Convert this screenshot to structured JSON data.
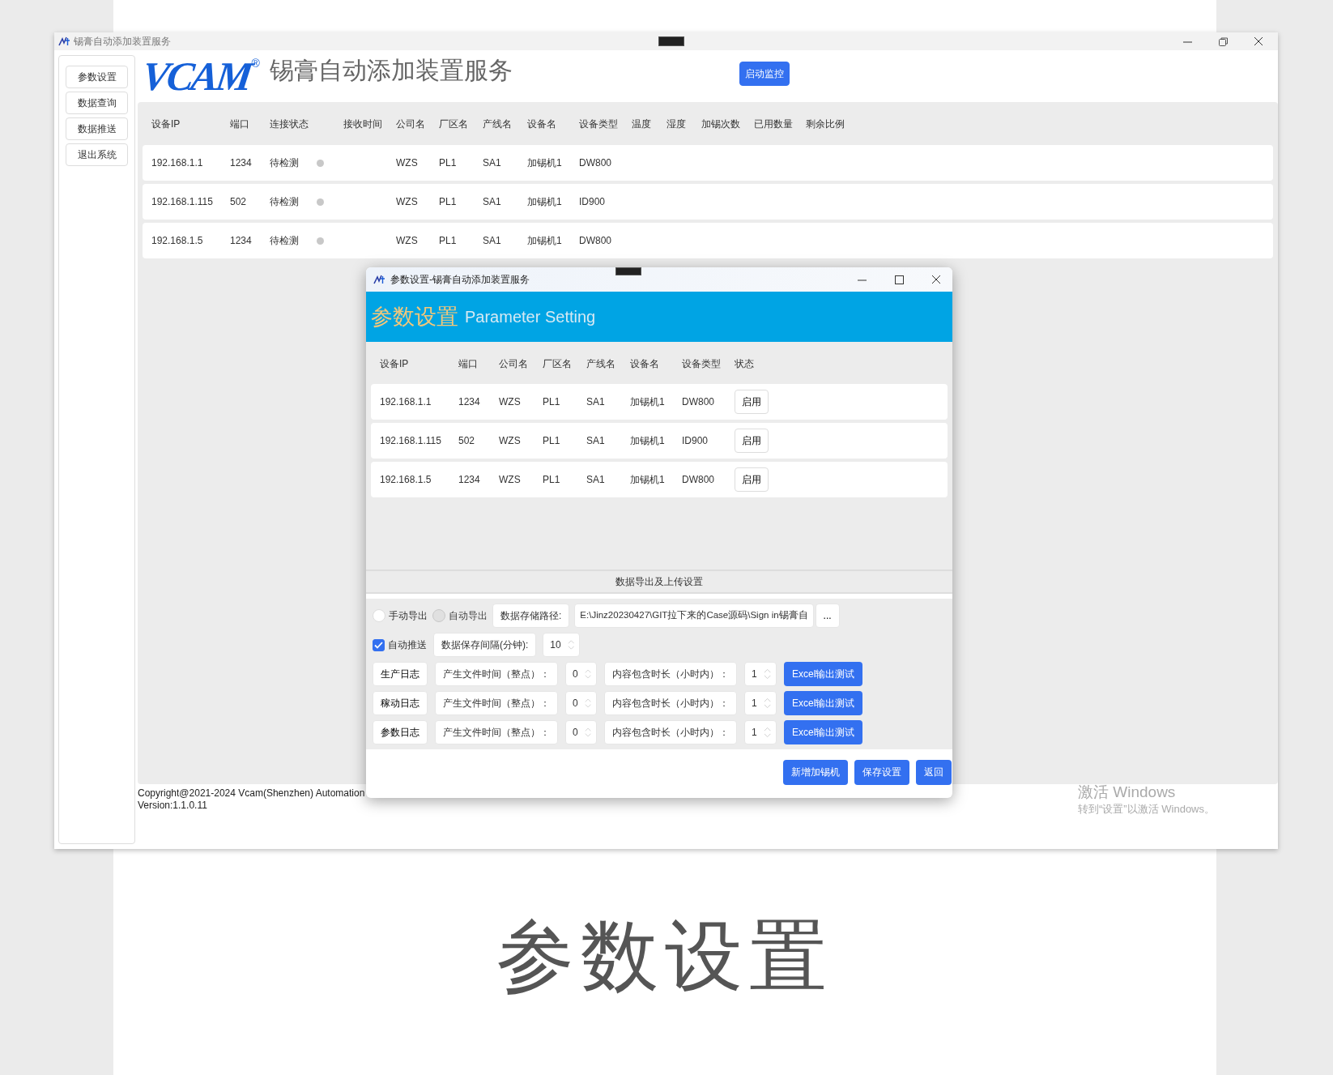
{
  "main_window": {
    "title": "锡膏自动添加装置服务",
    "sidebar": {
      "items": [
        {
          "label": "参数设置"
        },
        {
          "label": "数据查询"
        },
        {
          "label": "数据推送"
        },
        {
          "label": "退出系统"
        }
      ]
    },
    "logo": {
      "text": "VCAM",
      "mark": "®"
    },
    "app_title": "锡膏自动添加装置服务",
    "start_button": "启动监控",
    "table": {
      "columns": [
        "设备IP",
        "端口",
        "连接状态",
        "接收时间",
        "公司名",
        "厂区名",
        "产线名",
        "设备名",
        "设备类型",
        "温度",
        "湿度",
        "加锡次数",
        "已用数量",
        "剩余比例"
      ],
      "rows": [
        {
          "ip": "192.168.1.1",
          "port": "1234",
          "connection": "待检测",
          "color": "#c8c8c8",
          "company": "WZS",
          "plant": "PL1",
          "line": "SA1",
          "device": "加锡机1",
          "type": "DW800"
        },
        {
          "ip": "192.168.1.115",
          "port": "502",
          "connection": "待检测",
          "color": "#c8c8c8",
          "company": "WZS",
          "plant": "PL1",
          "line": "SA1",
          "device": "加锡机1",
          "type": "ID900"
        },
        {
          "ip": "192.168.1.5",
          "port": "1234",
          "connection": "待检测",
          "color": "#c8c8c8",
          "company": "WZS",
          "plant": "PL1",
          "line": "SA1",
          "device": "加锡机1",
          "type": "DW800"
        }
      ]
    },
    "footer": {
      "copyright": "Copyright@2021-2024 Vcam(Shenzhen) Automation",
      "version": "Version:1.1.0.11"
    },
    "activation": {
      "title": "激活 Windows",
      "text": "转到“设置”以激活 Windows。"
    }
  },
  "dialog": {
    "title": "参数设置-锡膏自动添加装置服务",
    "heading": "参数设置",
    "subheading": "Parameter Setting",
    "table": {
      "columns": [
        "设备IP",
        "端口",
        "公司名",
        "厂区名",
        "产线名",
        "设备名",
        "设备类型",
        "状态"
      ],
      "rows": [
        {
          "ip": "192.168.1.1",
          "port": "1234",
          "company": "WZS",
          "plant": "PL1",
          "line": "SA1",
          "device": "加锡机1",
          "type": "DW800",
          "action": "启用"
        },
        {
          "ip": "192.168.1.115",
          "port": "502",
          "company": "WZS",
          "plant": "PL1",
          "line": "SA1",
          "device": "加锡机1",
          "type": "ID900",
          "action": "启用"
        },
        {
          "ip": "192.168.1.5",
          "port": "1234",
          "company": "WZS",
          "plant": "PL1",
          "line": "SA1",
          "device": "加锡机1",
          "type": "DW800",
          "action": "启用"
        }
      ]
    },
    "section_title": "数据导出及上传设置",
    "export_modes": [
      {
        "label": "手动导出",
        "selected": false,
        "disabled": false
      },
      {
        "label": "自动导出",
        "selected": false,
        "disabled": true
      }
    ],
    "path_label": "数据存储路径:",
    "path_value": "E:\\Jinz20230427\\GIT拉下来的Case源码\\Sign in锡膏自",
    "browse_button": "...",
    "auto_push": {
      "label": "自动推送",
      "checked": true
    },
    "interval_label": "数据保存间隔(分钟):",
    "interval_value": "10",
    "logs": [
      {
        "name": "生产日志",
        "time_label": "产生文件时间（整点）：",
        "time_value": "0",
        "duration_label": "内容包含时长（小时内）：",
        "duration_value": "1",
        "test_button": "Excel输出测试"
      },
      {
        "name": "稼动日志",
        "time_label": "产生文件时间（整点）：",
        "time_value": "0",
        "duration_label": "内容包含时长（小时内）：",
        "duration_value": "1",
        "test_button": "Excel输出测试"
      },
      {
        "name": "参数日志",
        "time_label": "产生文件时间（整点）：",
        "time_value": "0",
        "duration_label": "内容包含时长（小时内）：",
        "duration_value": "1",
        "test_button": "Excel输出测试"
      }
    ],
    "buttons": [
      "新增加锡机",
      "保存设置",
      "返回"
    ]
  },
  "caption": "参数设置"
}
